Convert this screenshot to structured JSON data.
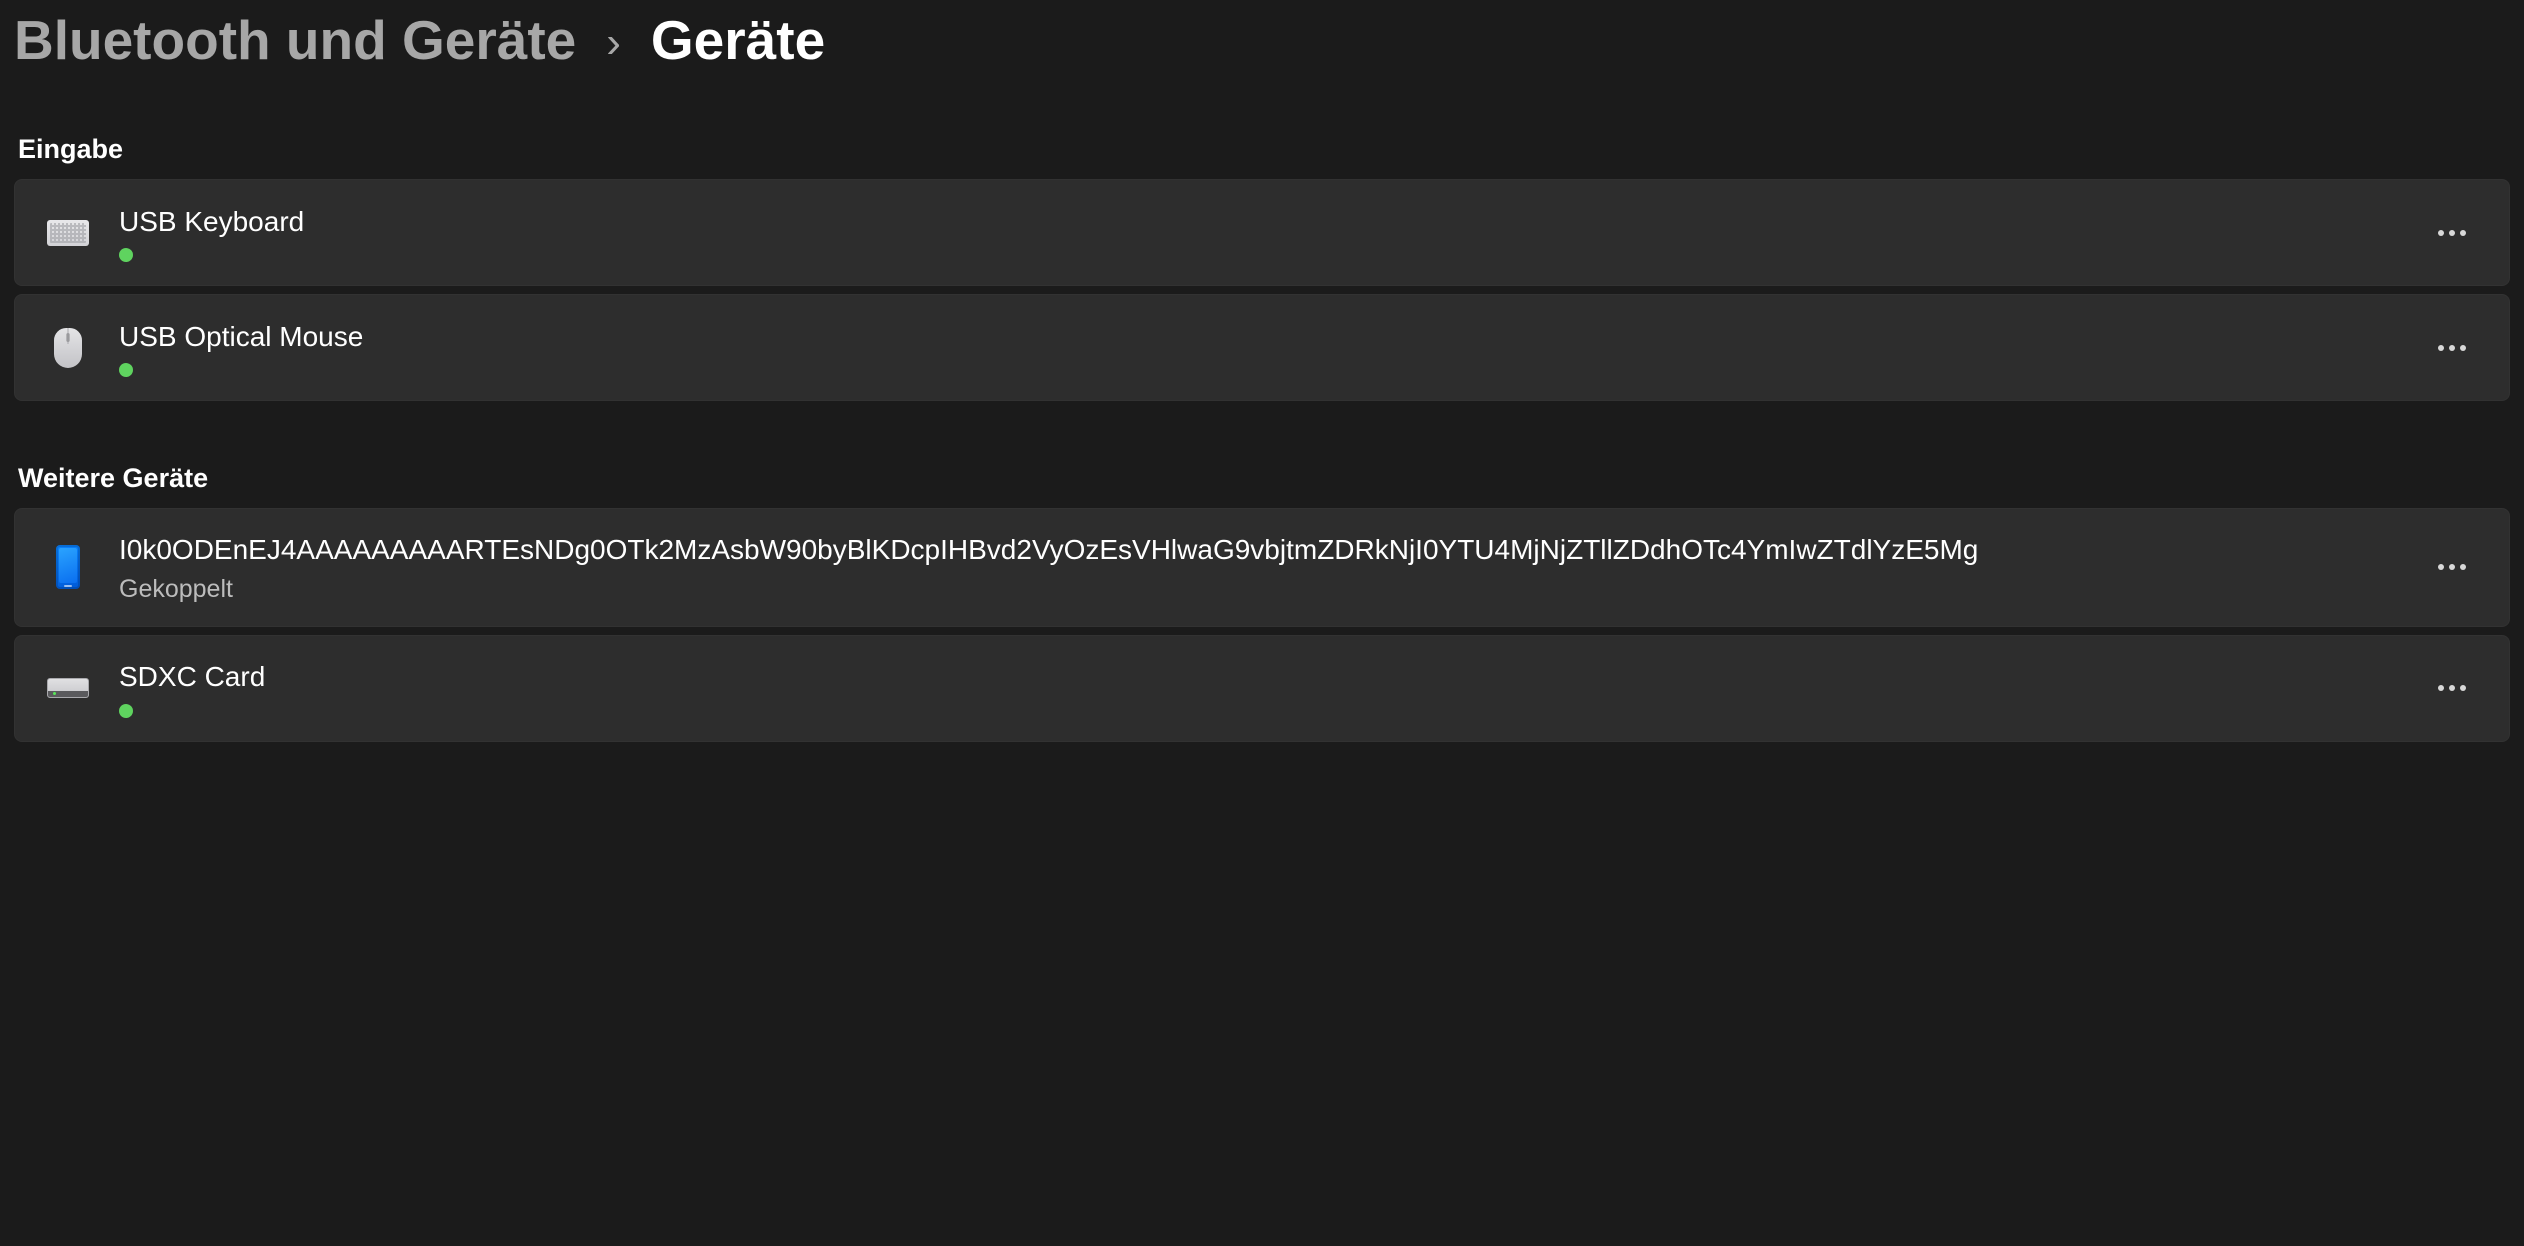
{
  "breadcrumb": {
    "parent": "Bluetooth und Geräte",
    "current": "Geräte"
  },
  "sections": {
    "input": {
      "title": "Eingabe",
      "devices": [
        {
          "name": "USB Keyboard"
        },
        {
          "name": "USB Optical Mouse"
        }
      ]
    },
    "other": {
      "title": "Weitere Geräte",
      "devices": [
        {
          "name": "I0k0ODEnEJ4AAAAAAAAARTEsNDg0OTk2MzAsbW90byBlKDcpIHBvd2VyOzEsVHlwaG9vbjtmZDRkNjI0YTU4MjNjZTllZDdhOTc4YmIwZTdlYzE5Mg",
          "status": "Gekoppelt"
        },
        {
          "name": "SDXC Card"
        }
      ]
    }
  }
}
